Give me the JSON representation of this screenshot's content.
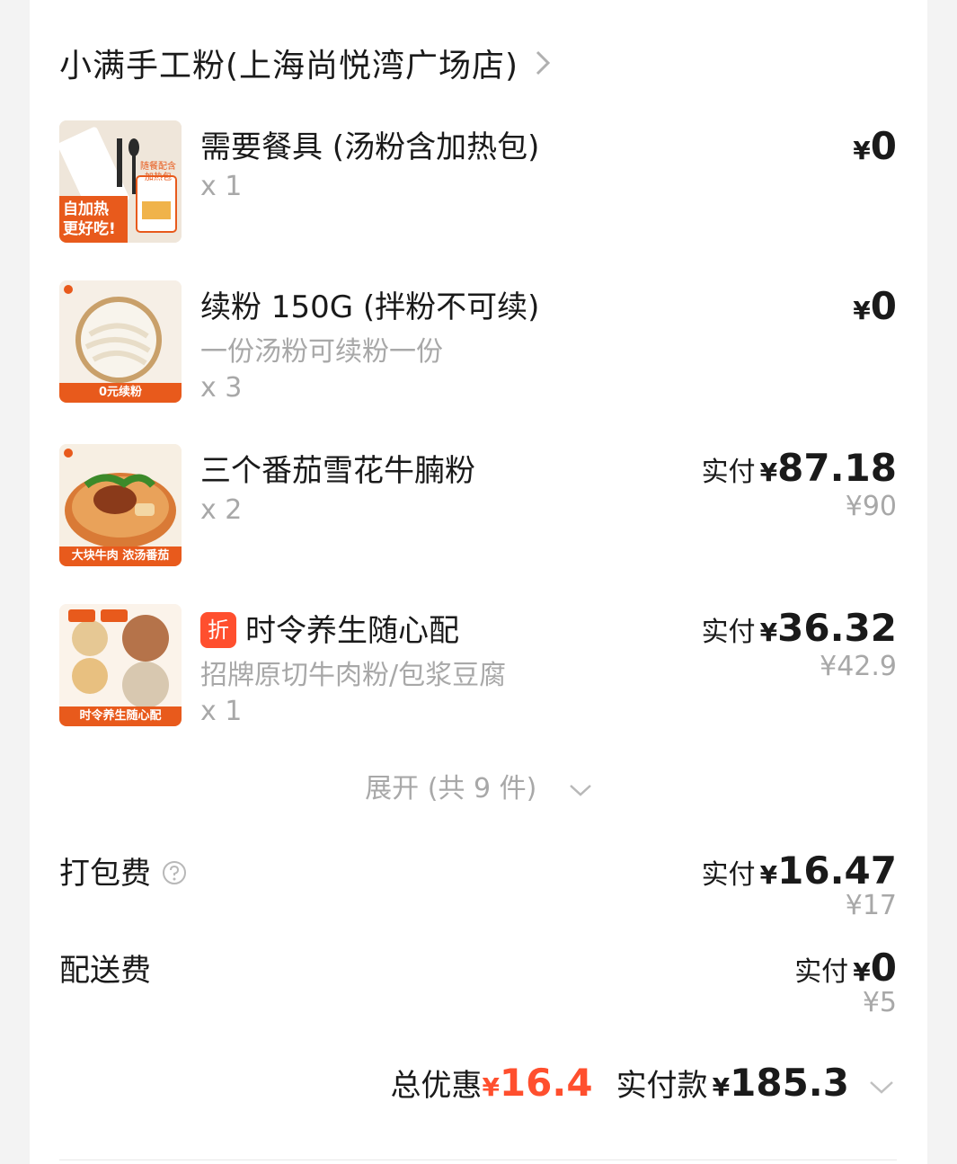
{
  "shop": {
    "name": "小满手工粉(上海尚悦湾广场店)",
    "chevron": "chevron-right-icon"
  },
  "items": [
    {
      "title": "需要餐具 (汤粉含加热包)",
      "subtitle": "",
      "qty": "x 1",
      "price_label": "",
      "currency": "¥",
      "price": "0",
      "original_price": "",
      "thumb_banner": "自加热 更好吃!",
      "thumb_badge": "随餐配含 加热包"
    },
    {
      "title": "续粉 150G (拌粉不可续)",
      "subtitle": "一份汤粉可续粉一份",
      "qty": "x 3",
      "price_label": "",
      "currency": "¥",
      "price": "0",
      "original_price": "",
      "thumb_banner": "0元续粉"
    },
    {
      "title": "三个番茄雪花牛腩粉",
      "subtitle": "",
      "qty": "x 2",
      "price_label": "实付",
      "currency": "¥",
      "price": "87.18",
      "original_price": "¥90",
      "thumb_banner": "大块牛肉 浓汤番茄"
    },
    {
      "title": "时令养生随心配",
      "discount_tag": "折",
      "subtitle": "招牌原切牛肉粉/包浆豆腐",
      "qty": "x 1",
      "price_label": "实付",
      "currency": "¥",
      "price": "36.32",
      "original_price": "¥42.9",
      "thumb_banner": "时令养生随心配"
    }
  ],
  "expand": {
    "label": "展开 (共 9 件)",
    "icon": "chevron-down-icon"
  },
  "fees": {
    "packing": {
      "label": "打包费",
      "icon": "help-icon",
      "price_label": "实付",
      "currency": "¥",
      "price": "16.47",
      "original_price": "¥17"
    },
    "delivery": {
      "label": "配送费",
      "price_label": "实付",
      "currency": "¥",
      "price": "0",
      "original_price": "¥5"
    }
  },
  "total": {
    "discount_label": "总优惠",
    "discount_currency": "¥",
    "discount_value": "16.4",
    "paid_label": "实付款",
    "paid_currency": "¥",
    "paid_value": "185.3",
    "icon": "chevron-down-icon"
  },
  "colors": {
    "accent_red": "#ff4f2e",
    "muted": "#a8a8a8",
    "banner_orange": "#e85a1c"
  }
}
